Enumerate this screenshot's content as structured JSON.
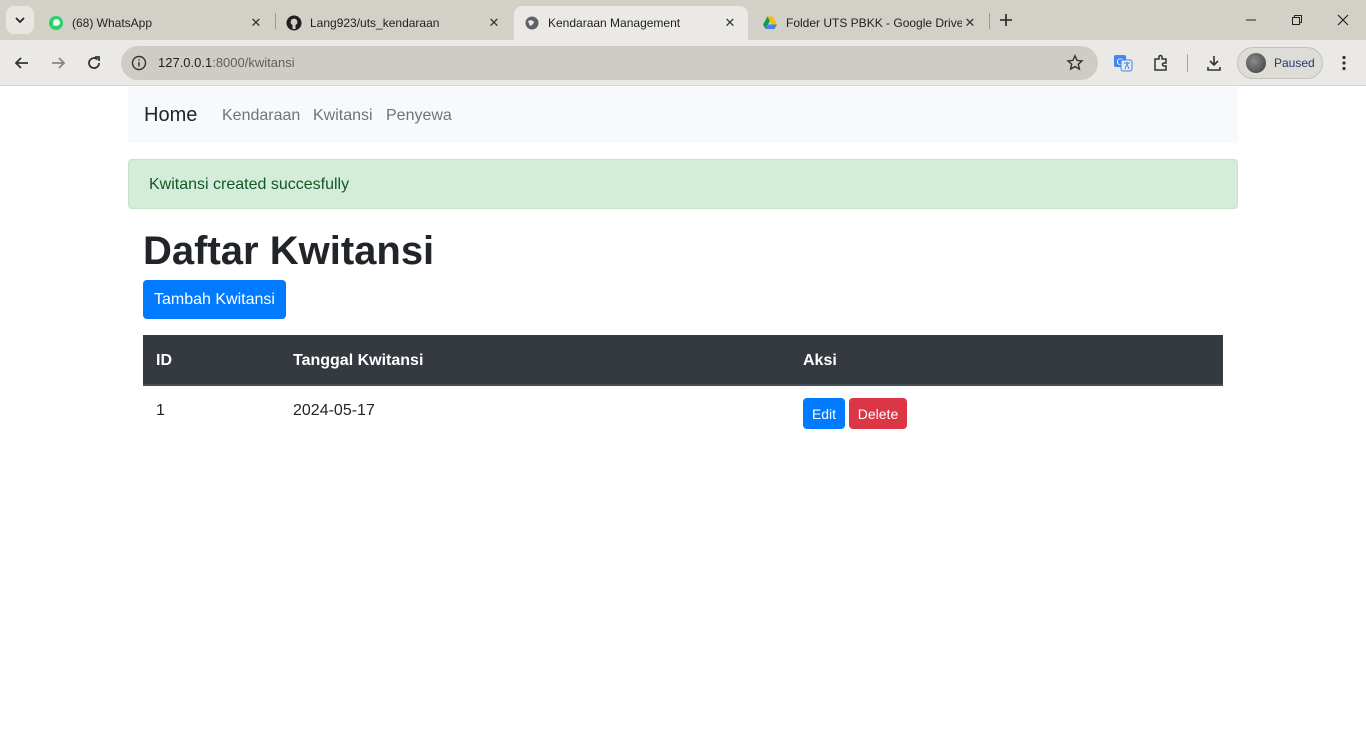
{
  "browser": {
    "tabs": [
      {
        "title": "(68) WhatsApp",
        "icon": "whatsapp-icon"
      },
      {
        "title": "Lang923/uts_kendaraan",
        "icon": "github-icon"
      },
      {
        "title": "Kendaraan Management",
        "icon": "globe-icon"
      },
      {
        "title": "Folder UTS PBKK - Google Drive",
        "icon": "google-drive-icon"
      }
    ],
    "url_host": "127.0.0.1",
    "url_path": ":8000/kwitansi",
    "profile_label": "Paused"
  },
  "navbar": {
    "brand": "Home",
    "links": [
      "Kendaraan",
      "Kwitansi",
      "Penyewa"
    ]
  },
  "alert": {
    "message": "Kwitansi created succesfully"
  },
  "main": {
    "title": "Daftar Kwitansi",
    "add_button": "Tambah Kwitansi"
  },
  "table": {
    "headers": [
      "ID",
      "Tanggal Kwitansi",
      "Aksi"
    ],
    "rows": [
      {
        "id": "1",
        "tanggal": "2024-05-17",
        "edit_label": "Edit",
        "delete_label": "Delete"
      }
    ]
  },
  "colors": {
    "primary": "#007bff",
    "danger": "#dc3545",
    "table_header": "#343a40",
    "alert_bg": "#d4edda"
  }
}
